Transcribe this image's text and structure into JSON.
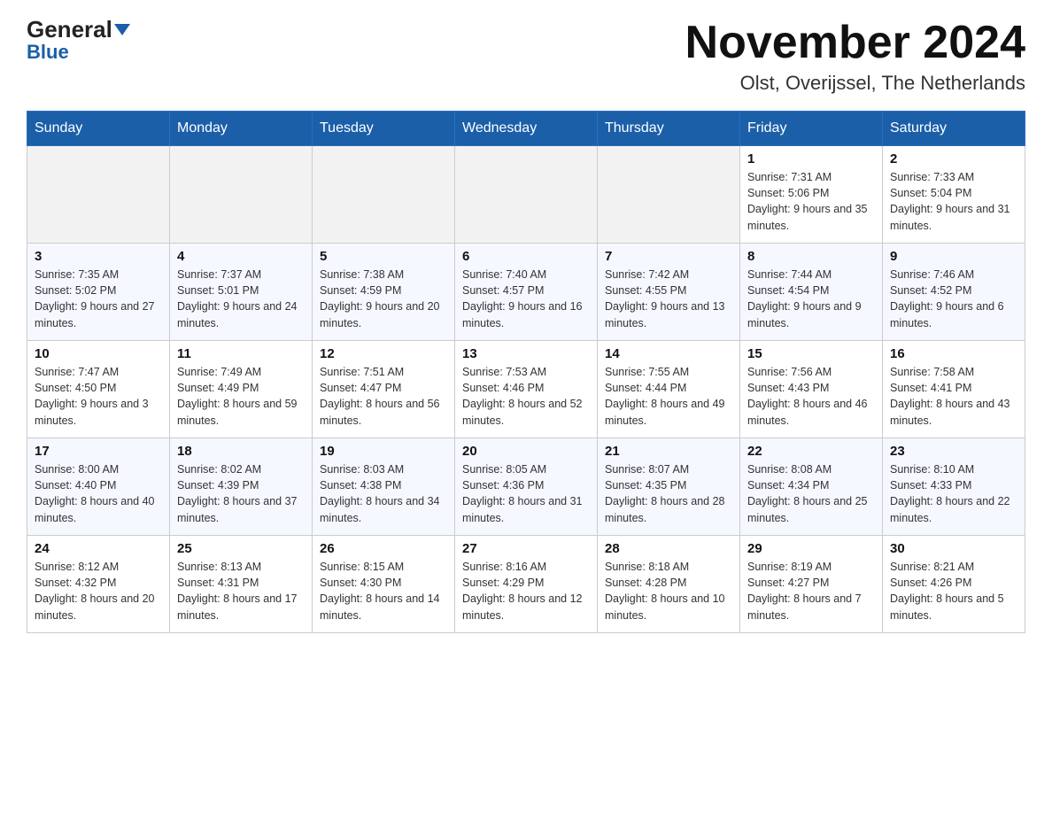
{
  "header": {
    "logo_general": "General",
    "logo_blue": "Blue",
    "month_title": "November 2024",
    "location": "Olst, Overijssel, The Netherlands"
  },
  "weekdays": [
    "Sunday",
    "Monday",
    "Tuesday",
    "Wednesday",
    "Thursday",
    "Friday",
    "Saturday"
  ],
  "weeks": [
    [
      {
        "day": "",
        "empty": true
      },
      {
        "day": "",
        "empty": true
      },
      {
        "day": "",
        "empty": true
      },
      {
        "day": "",
        "empty": true
      },
      {
        "day": "",
        "empty": true
      },
      {
        "day": "1",
        "sunrise": "7:31 AM",
        "sunset": "5:06 PM",
        "daylight": "9 hours and 35 minutes."
      },
      {
        "day": "2",
        "sunrise": "7:33 AM",
        "sunset": "5:04 PM",
        "daylight": "9 hours and 31 minutes."
      }
    ],
    [
      {
        "day": "3",
        "sunrise": "7:35 AM",
        "sunset": "5:02 PM",
        "daylight": "9 hours and 27 minutes."
      },
      {
        "day": "4",
        "sunrise": "7:37 AM",
        "sunset": "5:01 PM",
        "daylight": "9 hours and 24 minutes."
      },
      {
        "day": "5",
        "sunrise": "7:38 AM",
        "sunset": "4:59 PM",
        "daylight": "9 hours and 20 minutes."
      },
      {
        "day": "6",
        "sunrise": "7:40 AM",
        "sunset": "4:57 PM",
        "daylight": "9 hours and 16 minutes."
      },
      {
        "day": "7",
        "sunrise": "7:42 AM",
        "sunset": "4:55 PM",
        "daylight": "9 hours and 13 minutes."
      },
      {
        "day": "8",
        "sunrise": "7:44 AM",
        "sunset": "4:54 PM",
        "daylight": "9 hours and 9 minutes."
      },
      {
        "day": "9",
        "sunrise": "7:46 AM",
        "sunset": "4:52 PM",
        "daylight": "9 hours and 6 minutes."
      }
    ],
    [
      {
        "day": "10",
        "sunrise": "7:47 AM",
        "sunset": "4:50 PM",
        "daylight": "9 hours and 3 minutes."
      },
      {
        "day": "11",
        "sunrise": "7:49 AM",
        "sunset": "4:49 PM",
        "daylight": "8 hours and 59 minutes."
      },
      {
        "day": "12",
        "sunrise": "7:51 AM",
        "sunset": "4:47 PM",
        "daylight": "8 hours and 56 minutes."
      },
      {
        "day": "13",
        "sunrise": "7:53 AM",
        "sunset": "4:46 PM",
        "daylight": "8 hours and 52 minutes."
      },
      {
        "day": "14",
        "sunrise": "7:55 AM",
        "sunset": "4:44 PM",
        "daylight": "8 hours and 49 minutes."
      },
      {
        "day": "15",
        "sunrise": "7:56 AM",
        "sunset": "4:43 PM",
        "daylight": "8 hours and 46 minutes."
      },
      {
        "day": "16",
        "sunrise": "7:58 AM",
        "sunset": "4:41 PM",
        "daylight": "8 hours and 43 minutes."
      }
    ],
    [
      {
        "day": "17",
        "sunrise": "8:00 AM",
        "sunset": "4:40 PM",
        "daylight": "8 hours and 40 minutes."
      },
      {
        "day": "18",
        "sunrise": "8:02 AM",
        "sunset": "4:39 PM",
        "daylight": "8 hours and 37 minutes."
      },
      {
        "day": "19",
        "sunrise": "8:03 AM",
        "sunset": "4:38 PM",
        "daylight": "8 hours and 34 minutes."
      },
      {
        "day": "20",
        "sunrise": "8:05 AM",
        "sunset": "4:36 PM",
        "daylight": "8 hours and 31 minutes."
      },
      {
        "day": "21",
        "sunrise": "8:07 AM",
        "sunset": "4:35 PM",
        "daylight": "8 hours and 28 minutes."
      },
      {
        "day": "22",
        "sunrise": "8:08 AM",
        "sunset": "4:34 PM",
        "daylight": "8 hours and 25 minutes."
      },
      {
        "day": "23",
        "sunrise": "8:10 AM",
        "sunset": "4:33 PM",
        "daylight": "8 hours and 22 minutes."
      }
    ],
    [
      {
        "day": "24",
        "sunrise": "8:12 AM",
        "sunset": "4:32 PM",
        "daylight": "8 hours and 20 minutes."
      },
      {
        "day": "25",
        "sunrise": "8:13 AM",
        "sunset": "4:31 PM",
        "daylight": "8 hours and 17 minutes."
      },
      {
        "day": "26",
        "sunrise": "8:15 AM",
        "sunset": "4:30 PM",
        "daylight": "8 hours and 14 minutes."
      },
      {
        "day": "27",
        "sunrise": "8:16 AM",
        "sunset": "4:29 PM",
        "daylight": "8 hours and 12 minutes."
      },
      {
        "day": "28",
        "sunrise": "8:18 AM",
        "sunset": "4:28 PM",
        "daylight": "8 hours and 10 minutes."
      },
      {
        "day": "29",
        "sunrise": "8:19 AM",
        "sunset": "4:27 PM",
        "daylight": "8 hours and 7 minutes."
      },
      {
        "day": "30",
        "sunrise": "8:21 AM",
        "sunset": "4:26 PM",
        "daylight": "8 hours and 5 minutes."
      }
    ]
  ]
}
